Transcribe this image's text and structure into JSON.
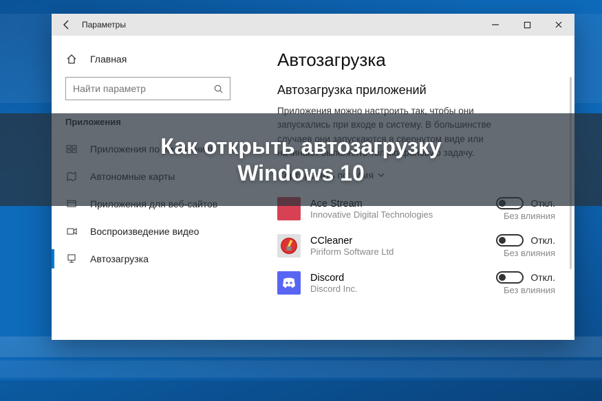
{
  "overlay": {
    "line1": "Как открыть автозагрузку",
    "line2": "Windows 10"
  },
  "window": {
    "title": "Параметры"
  },
  "sidebar": {
    "home": "Главная",
    "search_placeholder": "Найти параметр",
    "section": "Приложения",
    "items": [
      {
        "label": "Приложения по умолчанию"
      },
      {
        "label": "Автономные карты"
      },
      {
        "label": "Приложения для веб-сайтов"
      },
      {
        "label": "Воспроизведение видео"
      },
      {
        "label": "Автозагрузка"
      }
    ]
  },
  "content": {
    "h1": "Автозагрузка",
    "h2": "Автозагрузка приложений",
    "description": "Приложения можно настроить так, чтобы они запускались при входе в систему. В большинстве случаев они запускаются в свернутом виде или начинают выполнять только фоновую задачу.",
    "sort_label": "Сортировать по:",
    "sort_value": "Имя",
    "apps": [
      {
        "name": "Ace Stream",
        "publisher": "Innovative Digital Technologies",
        "toggle": "Откл.",
        "impact": "Без влияния",
        "color": "#d84154",
        "icon": "blank"
      },
      {
        "name": "CCleaner",
        "publisher": "Piriform Software Ltd",
        "toggle": "Откл.",
        "impact": "Без влияния",
        "color": "#e0e0e0",
        "icon": "ccleaner"
      },
      {
        "name": "Discord",
        "publisher": "Discord Inc.",
        "toggle": "Откл.",
        "impact": "Без влияния",
        "color": "#5865f2",
        "icon": "discord"
      }
    ]
  }
}
